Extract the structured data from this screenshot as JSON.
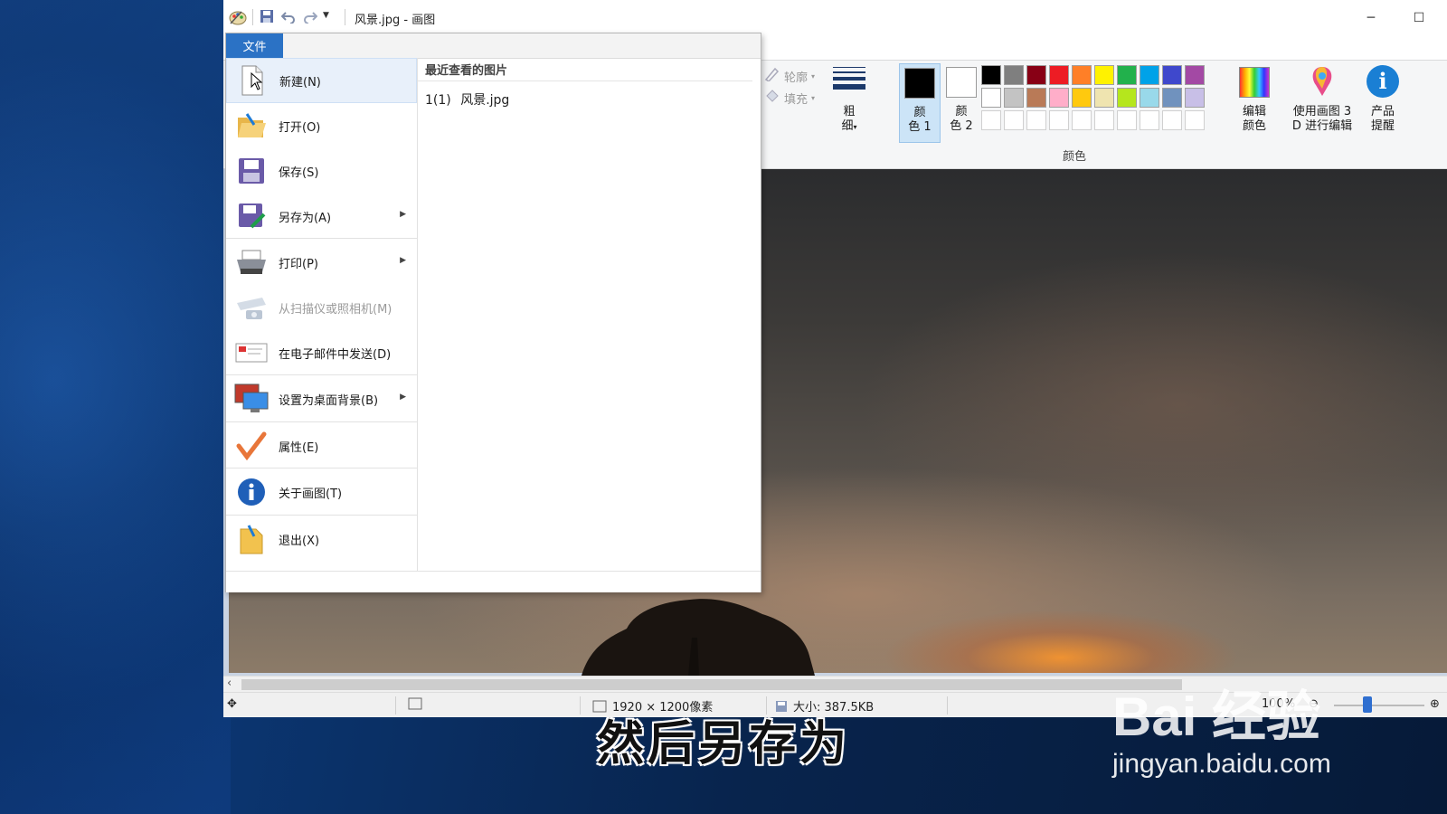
{
  "window": {
    "title": "风景.jpg - 画图",
    "minimize_glyph": "─",
    "maximize_glyph": "☐"
  },
  "ribbon": {
    "outline_label": "轮廓",
    "fill_label": "填充",
    "size_label_1": "粗",
    "size_label_2": "细",
    "color1_label_1": "颜",
    "color1_label_2": "色 1",
    "color2_label_1": "颜",
    "color2_label_2": "色 2",
    "edit_colors_1": "编辑",
    "edit_colors_2": "颜色",
    "paint3d_1": "使用画图 3",
    "paint3d_2": "D 进行编辑",
    "product_alert_1": "产品",
    "product_alert_2": "提醒",
    "colors_group_label": "颜色",
    "color1_value": "#000000",
    "color2_value": "#ffffff",
    "palette": [
      "#000000",
      "#7f7f7f",
      "#880015",
      "#ed1c24",
      "#ff7f27",
      "#fff200",
      "#22b14c",
      "#00a2e8",
      "#3f48cc",
      "#a349a4",
      "#ffffff",
      "#c3c3c3",
      "#b97a57",
      "#ffaec9",
      "#ffc90e",
      "#efe4b0",
      "#b5e61d",
      "#99d9ea",
      "#7092be",
      "#c8bfe7",
      "#ffffff",
      "#ffffff",
      "#ffffff",
      "#ffffff",
      "#ffffff",
      "#ffffff",
      "#ffffff",
      "#ffffff",
      "#ffffff",
      "#ffffff"
    ]
  },
  "file_menu": {
    "tab_label": "文件",
    "items": [
      {
        "label": "新建(N)",
        "icon": "new-file-icon",
        "arrow": ""
      },
      {
        "label": "打开(O)",
        "icon": "open-folder-icon",
        "arrow": ""
      },
      {
        "label": "保存(S)",
        "icon": "save-disk-icon",
        "arrow": ""
      },
      {
        "label": "另存为(A)",
        "icon": "save-as-icon",
        "arrow": "▶"
      },
      {
        "label": "打印(P)",
        "icon": "printer-icon",
        "arrow": "▶"
      },
      {
        "label": "从扫描仪或照相机(M)",
        "icon": "scanner-icon",
        "arrow": ""
      },
      {
        "label": "在电子邮件中发送(D)",
        "icon": "email-icon",
        "arrow": ""
      },
      {
        "label": "设置为桌面背景(B)",
        "icon": "desktop-background-icon",
        "arrow": "▶"
      },
      {
        "label": "属性(E)",
        "icon": "checkmark-icon",
        "arrow": ""
      },
      {
        "label": "关于画图(T)",
        "icon": "info-icon",
        "arrow": ""
      },
      {
        "label": "退出(X)",
        "icon": "exit-folder-icon",
        "arrow": ""
      }
    ],
    "recent_header": "最近查看的图片",
    "recent_items": [
      {
        "index": "1(1)",
        "name": "风景.jpg"
      }
    ]
  },
  "statusbar": {
    "dimensions": "1920 × 1200像素",
    "size": "大小: 387.5KB",
    "zoom": "100%"
  },
  "overlay": {
    "subtitle": "然后另存为",
    "watermark_brand": "Bai 经验",
    "watermark_url": "jingyan.baidu.com"
  }
}
